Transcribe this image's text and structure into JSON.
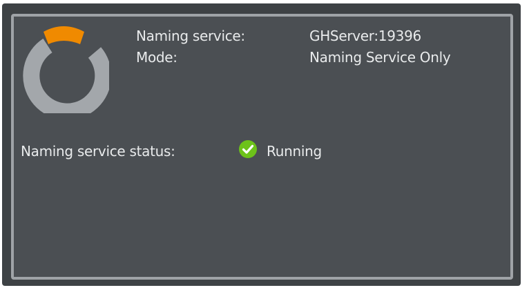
{
  "info": {
    "naming_service_label": "Naming service:",
    "naming_service_value": "GHServer:19396",
    "mode_label": "Mode:",
    "mode_value": "Naming Service Only"
  },
  "status": {
    "label": "Naming service status:",
    "value": "Running",
    "icon": "check-circle-icon",
    "color": "#6dc21a"
  },
  "colors": {
    "panel_bg": "#4b4f53",
    "panel_border": "#9fa3a7",
    "logo_accent": "#f08a00",
    "logo_ring": "#a3a7ab"
  }
}
